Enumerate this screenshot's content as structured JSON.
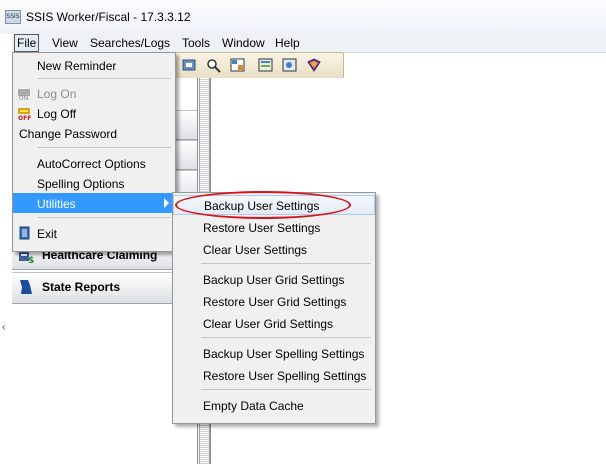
{
  "window": {
    "title": "SSIS Worker/Fiscal - 17.3.3.12",
    "icon_label": "SSIS"
  },
  "menubar": {
    "items": [
      "File",
      "View",
      "Searches/Logs",
      "Tools",
      "Window",
      "Help"
    ]
  },
  "file_menu": {
    "items": [
      {
        "label": "New Reminder",
        "enabled": true,
        "icon": ""
      },
      {
        "label": "Log On",
        "enabled": false,
        "icon": "log-on-icon"
      },
      {
        "label": "Log Off",
        "enabled": true,
        "icon": "log-off-icon"
      },
      {
        "label": "Change Password",
        "enabled": true,
        "icon": ""
      },
      {
        "label": "AutoCorrect Options",
        "enabled": true,
        "icon": ""
      },
      {
        "label": "Spelling Options",
        "enabled": true,
        "icon": ""
      },
      {
        "label": "Utilities",
        "enabled": true,
        "icon": "",
        "highlighted": true,
        "submenu": true
      },
      {
        "label": "Exit",
        "enabled": true,
        "icon": "exit-icon"
      }
    ]
  },
  "utilities_menu": {
    "items": [
      "Backup User Settings",
      "Restore User Settings",
      "Clear User Settings",
      "Backup User Grid Settings",
      "Restore User Grid Settings",
      "Clear User Grid Settings",
      "Backup User Spelling Settings",
      "Restore User Spelling Settings",
      "Empty Data Cache"
    ],
    "hovered": "Backup User Settings"
  },
  "navbar": {
    "items": [
      "Healthcare Claiming",
      "State Reports"
    ]
  },
  "colors": {
    "highlight": "#3399ff",
    "annotation_ring": "#d8141a",
    "menu_bg": "#f0f0f0"
  },
  "glyphs": {
    "left_edge": "‹",
    "splitter_arrow": "‹"
  }
}
